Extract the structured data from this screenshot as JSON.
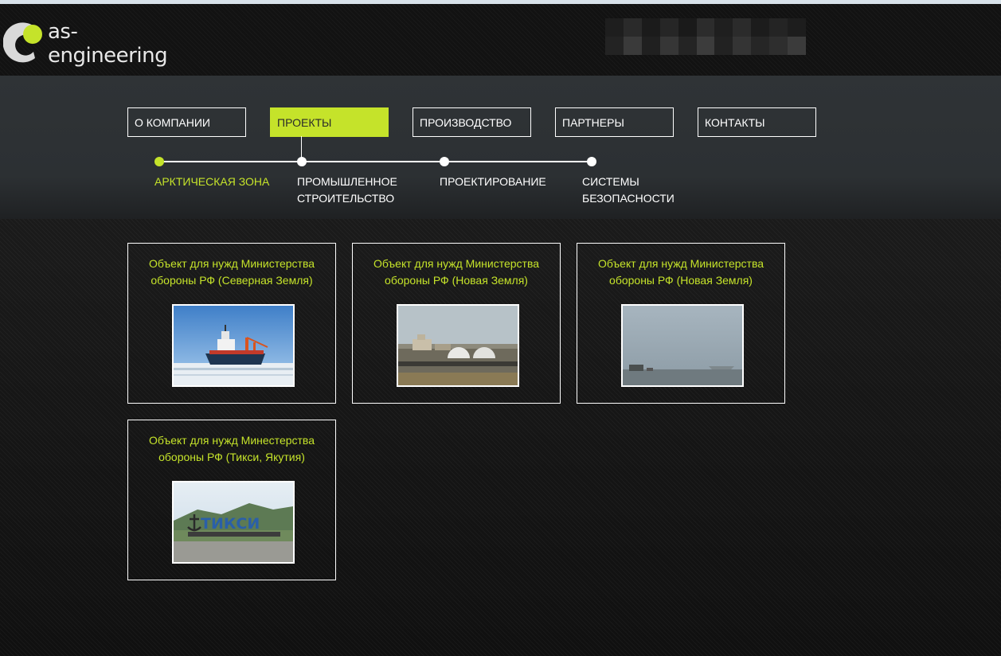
{
  "brand": {
    "name": "as-engineering"
  },
  "nav": {
    "items": [
      {
        "label": "О КОМПАНИИ"
      },
      {
        "label": "ПРОЕКТЫ"
      },
      {
        "label": "ПРОИЗВОДСТВО"
      },
      {
        "label": "ПАРТНЕРЫ"
      },
      {
        "label": "КОНТАКТЫ"
      }
    ],
    "active": "ПРОЕКТЫ"
  },
  "subnav": {
    "items": [
      {
        "label": "АРКТИЧЕСКАЯ ЗОНА"
      },
      {
        "label": "ПРОМЫШЛЕННОЕ СТРОИТЕЛЬСТВО"
      },
      {
        "label": "ПРОЕКТИРОВАНИЕ"
      },
      {
        "label": "СИСТЕМЫ БЕЗОПАСНОСТИ"
      }
    ],
    "active": "АРКТИЧЕСКАЯ ЗОНА"
  },
  "projects": [
    {
      "title": "Объект для нужд Министерства обороны РФ (Северная Земля)",
      "image": "icebreaker-ship-photo"
    },
    {
      "title": "Объект для нужд Министерства обороны РФ (Новая Земля)",
      "image": "radar-domes-photo"
    },
    {
      "title": "Объект для нужд Министерства обороны РФ (Новая Земля)",
      "image": "foggy-airfield-photo"
    },
    {
      "title": "Объект для нужд Минестерства обороны РФ (Тикси, Якутия)",
      "image": "tiksi-sign-photo",
      "sign_text": "ТИКСИ"
    }
  ],
  "colors": {
    "accent": "#c5e32a",
    "header": "#121212",
    "nav_band": "#2f3336",
    "text": "#ffffff"
  }
}
